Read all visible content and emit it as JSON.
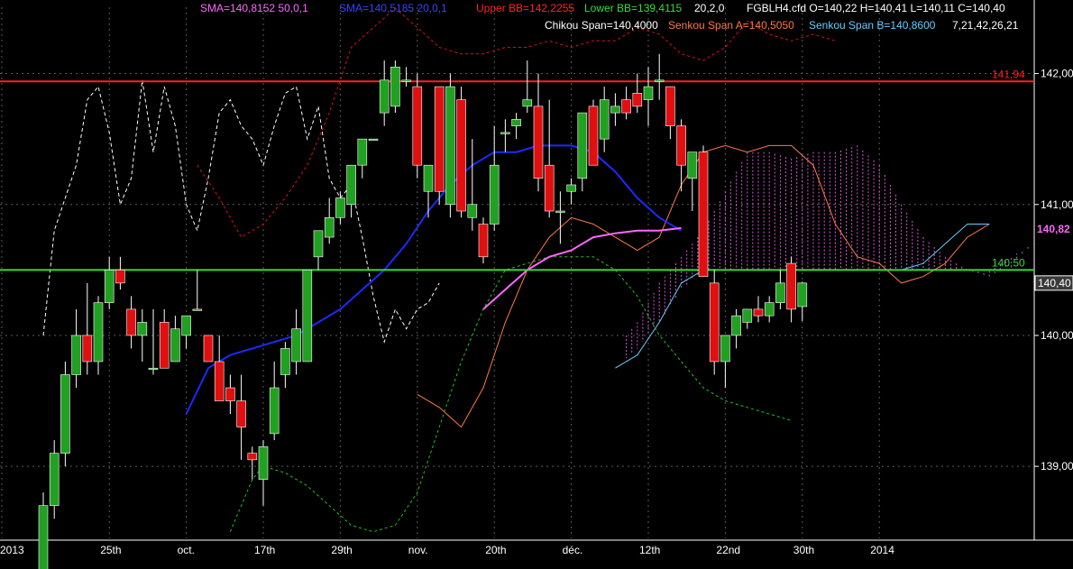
{
  "colors": {
    "background": "#000000",
    "grid": "#5a5a5a",
    "text": "#ffffff",
    "candle_up": "#22a022",
    "candle_down": "#e01010",
    "sma50": "#ff66ff",
    "sma20": "#1a2aff",
    "upper_bb": "#e01010",
    "lower_bb": "#22c022",
    "chikou": "#ffffff",
    "senkou_a": "#ff7744",
    "senkou_b": "#66ccff",
    "cloud": "#ff66ff",
    "resistance": "#ff2020",
    "support": "#33dd33"
  },
  "indicators": {
    "sma50": "SMA=140,8152  50,0,1",
    "sma20": "SMA=140,5185  20,0,1",
    "upper_bb": "Upper BB=142,2255",
    "lower_bb": "Lower BB=139,4115",
    "bb_params": "20,2,0",
    "ohlc": "FGBLH4.cfd O=140,22 H=140,41 L=140,11 C=140,40",
    "chikou": "Chikou Span=140,4000",
    "senkou_a": "Senkou Span A=140,5050",
    "senkou_b": "Senkou Span B=140,8600",
    "ichimoku_params": "7,21,42,26,21"
  },
  "chart_data": {
    "type": "candlestick",
    "ylim": [
      138.45,
      142.3
    ],
    "y_ticks": [
      "142,00",
      "141,00",
      "140,00",
      "139,00"
    ],
    "y_tick_values": [
      142.0,
      141.0,
      140.0,
      139.0
    ],
    "x_tick_labels": [
      "2013",
      "25th",
      "oct.",
      "17th",
      "29th",
      "nov.",
      "20th",
      "déc.",
      "12th",
      "22nd",
      "30th",
      "2014"
    ],
    "x_tick_index": [
      0,
      6,
      13,
      20,
      27,
      34,
      41,
      48,
      55,
      62,
      69,
      76
    ],
    "last_price_label": "140,40",
    "last_price": 140.4,
    "sma50_label": "140,82",
    "sma50_value": 140.82,
    "lines": [
      {
        "label": "141,94",
        "value": 141.94,
        "color": "resistance"
      },
      {
        "label": "140,50",
        "value": 140.5,
        "color": "support"
      }
    ],
    "candles": [
      [
        138.2,
        138.8,
        138.2,
        138.7
      ],
      [
        138.7,
        139.2,
        138.6,
        139.1
      ],
      [
        139.1,
        139.8,
        139.0,
        139.7
      ],
      [
        139.7,
        140.2,
        139.6,
        140.0
      ],
      [
        140.0,
        140.4,
        139.7,
        139.8
      ],
      [
        139.8,
        140.3,
        139.7,
        140.25
      ],
      [
        140.25,
        140.6,
        140.2,
        140.5
      ],
      [
        140.5,
        140.6,
        140.35,
        140.4
      ],
      [
        140.2,
        140.3,
        139.9,
        140.0
      ],
      [
        140.0,
        140.2,
        139.8,
        140.1
      ],
      [
        139.75,
        140.2,
        139.7,
        139.75
      ],
      [
        140.1,
        140.2,
        139.8,
        139.75
      ],
      [
        139.8,
        140.15,
        139.8,
        140.05
      ],
      [
        140.0,
        140.15,
        139.9,
        140.15
      ],
      [
        140.2,
        140.5,
        140.2,
        140.2
      ],
      [
        140.0,
        140.0,
        139.8,
        139.8
      ],
      [
        139.8,
        140.0,
        139.5,
        139.5
      ],
      [
        139.6,
        139.7,
        139.4,
        139.5
      ],
      [
        139.5,
        139.7,
        139.05,
        139.3
      ],
      [
        139.1,
        139.15,
        138.9,
        139.05
      ],
      [
        138.9,
        139.2,
        138.7,
        139.15
      ],
      [
        139.25,
        139.8,
        139.2,
        139.6
      ],
      [
        139.7,
        139.95,
        139.6,
        139.9
      ],
      [
        139.8,
        140.2,
        139.7,
        140.05
      ],
      [
        139.8,
        140.5,
        139.8,
        140.5
      ],
      [
        140.6,
        140.8,
        140.5,
        140.8
      ],
      [
        140.75,
        141.05,
        140.7,
        140.9
      ],
      [
        140.9,
        141.1,
        140.85,
        141.05
      ],
      [
        141.0,
        141.3,
        140.9,
        141.3
      ],
      [
        141.3,
        141.5,
        141.2,
        141.5
      ],
      [
        141.5,
        141.5,
        141.5,
        141.5
      ],
      [
        141.7,
        142.1,
        141.6,
        141.95
      ],
      [
        141.75,
        142.1,
        141.7,
        142.05
      ],
      [
        141.95,
        142.05,
        141.9,
        141.95
      ],
      [
        141.9,
        142.0,
        141.2,
        141.3
      ],
      [
        141.1,
        141.3,
        140.9,
        141.3
      ],
      [
        141.9,
        141.9,
        141.0,
        141.1
      ],
      [
        141.0,
        142.0,
        140.9,
        141.9
      ],
      [
        141.8,
        141.9,
        140.9,
        140.95
      ],
      [
        140.9,
        141.5,
        140.8,
        141.0
      ],
      [
        140.85,
        140.9,
        140.55,
        140.6
      ],
      [
        140.85,
        141.6,
        140.8,
        141.3
      ],
      [
        141.55,
        141.65,
        141.4,
        141.55
      ],
      [
        141.6,
        141.7,
        141.5,
        141.65
      ],
      [
        141.75,
        142.1,
        141.7,
        141.8
      ],
      [
        141.75,
        142.0,
        141.1,
        141.2
      ],
      [
        141.3,
        141.8,
        140.9,
        140.95
      ],
      [
        140.95,
        141.1,
        140.7,
        140.95
      ],
      [
        141.1,
        141.2,
        141.0,
        141.15
      ],
      [
        141.2,
        141.7,
        141.1,
        141.7
      ],
      [
        141.75,
        141.8,
        141.3,
        141.3
      ],
      [
        141.5,
        141.9,
        141.4,
        141.8
      ],
      [
        141.7,
        141.85,
        141.6,
        141.75
      ],
      [
        141.8,
        141.9,
        141.65,
        141.7
      ],
      [
        141.85,
        142.0,
        141.7,
        141.75
      ],
      [
        141.8,
        142.05,
        141.6,
        141.9
      ],
      [
        141.95,
        142.15,
        141.8,
        141.95
      ],
      [
        141.9,
        141.9,
        141.5,
        141.6
      ],
      [
        141.6,
        141.65,
        141.1,
        141.3
      ],
      [
        141.2,
        141.4,
        140.95,
        141.4
      ],
      [
        141.4,
        141.45,
        140.75,
        140.45
      ],
      [
        140.4,
        140.5,
        139.7,
        139.8
      ],
      [
        139.8,
        140.0,
        139.6,
        140.0
      ],
      [
        140.0,
        140.2,
        139.9,
        140.15
      ],
      [
        140.1,
        140.2,
        140.05,
        140.2
      ],
      [
        140.2,
        140.3,
        140.1,
        140.15
      ],
      [
        140.15,
        140.3,
        140.1,
        140.25
      ],
      [
        140.25,
        140.5,
        140.2,
        140.4
      ],
      [
        140.55,
        140.6,
        140.1,
        140.2
      ],
      [
        140.22,
        140.41,
        140.11,
        140.4
      ]
    ]
  }
}
